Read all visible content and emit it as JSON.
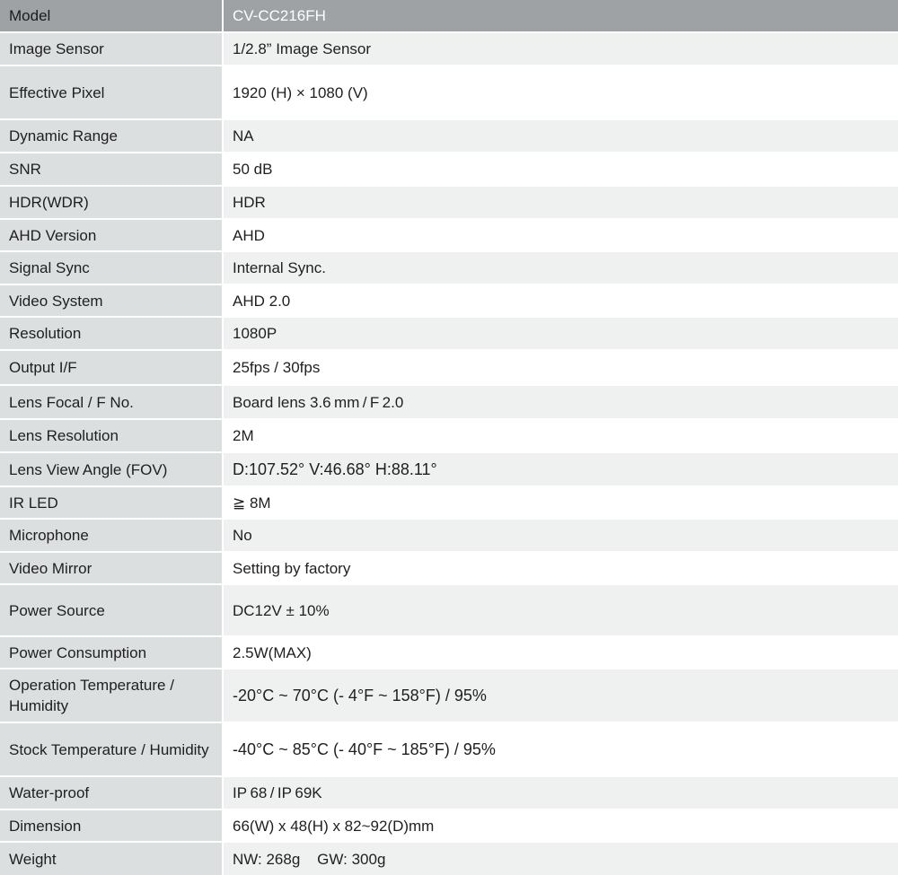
{
  "header": {
    "label": "Model",
    "value": "CV-CC216FH"
  },
  "rows": [
    {
      "label": "Image Sensor",
      "value": "1/2.8” Image Sensor"
    },
    {
      "label": "Effective Pixel",
      "value": "1920 (H) × 1080 (V)"
    },
    {
      "label": "Dynamic Range",
      "value": "NA"
    },
    {
      "label": "SNR",
      "value": "50 dB"
    },
    {
      "label": "HDR(WDR)",
      "value": "HDR"
    },
    {
      "label": "AHD Version",
      "value": "AHD"
    },
    {
      "label": "Signal Sync",
      "value": "Internal Sync."
    },
    {
      "label": "Video System",
      "value": "AHD 2.0"
    },
    {
      "label": "Resolution",
      "value": "1080P"
    },
    {
      "label": "Output I/F",
      "value": "25fps / 30fps"
    },
    {
      "label": "Lens Focal / F No.",
      "value": "Board lens 3.6 mm / F 2.0"
    },
    {
      "label": "Lens Resolution",
      "value": "2M"
    },
    {
      "label": "Lens View Angle (FOV)",
      "value": "D:107.52° V:46.68° H:88.11°"
    },
    {
      "label": "IR LED",
      "value": "≧ 8M"
    },
    {
      "label": "Microphone",
      "value": "No"
    },
    {
      "label": "Video Mirror",
      "value": "Setting by factory"
    },
    {
      "label": "Power Source",
      "value": "DC12V ± 10%"
    },
    {
      "label": "Power Consumption",
      "value": "2.5W(MAX)"
    },
    {
      "label": "Operation Temperature / Humidity",
      "value": "-20°C ~ 70°C (- 4°F ~ 158°F) / 95%"
    },
    {
      "label": "Stock Temperature / Humidity",
      "value": "-40°C ~ 85°C (- 40°F ~ 185°F) / 95%"
    },
    {
      "label": "Water-proof",
      "value": "IP 68 / IP 69K"
    },
    {
      "label": "Dimension",
      "value": "66(W) x 48(H) x 82~92(D)mm"
    },
    {
      "label": "Weight",
      "value": "NW: 268g    GW: 300g"
    }
  ]
}
